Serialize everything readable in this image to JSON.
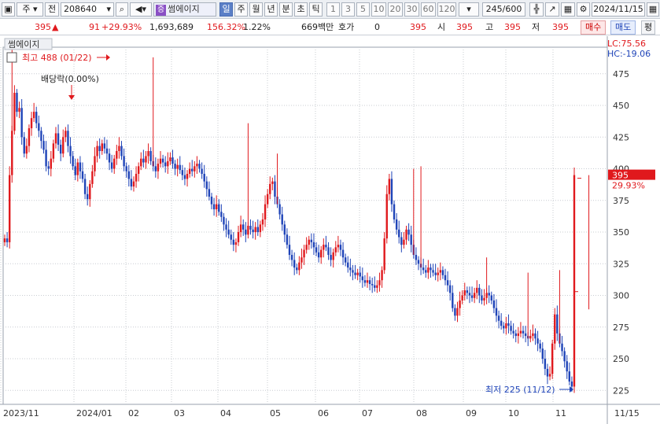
{
  "toolbar": {
    "market": "주",
    "prev_label": "전",
    "code": "208640",
    "name_tag": "증",
    "stock_name": "썸에이지",
    "periods": [
      "일",
      "주",
      "월",
      "년",
      "분",
      "초",
      "틱"
    ],
    "active_period": "일",
    "intervals": [
      "1",
      "3",
      "5",
      "10",
      "20",
      "30",
      "60",
      "120"
    ],
    "count": "245/600",
    "date": "2024/11/15"
  },
  "quote": {
    "price": "395",
    "change": "91",
    "change_pct": "+29.93%",
    "volume": "1,693,689",
    "volume_ratio": "156.32%",
    "turnover_pct": "1.22%",
    "amount": "669백만",
    "hoga_label": "호가",
    "hoga_value": "0",
    "hoga_price": "395",
    "open_label": "시",
    "open": "395",
    "high_label": "고",
    "high": "395",
    "low_label": "저",
    "low": "395",
    "buy_label": "매수",
    "sell_label": "매도",
    "avg_label": "평"
  },
  "chart_data": {
    "type": "candlestick",
    "title": "썸에이지",
    "y_ticks": [
      225,
      250,
      275,
      300,
      325,
      350,
      375,
      400,
      425,
      450,
      475
    ],
    "ylim": [
      214,
      496
    ],
    "x_labels": [
      "2023/11",
      "2024/01",
      "02",
      "03",
      "04",
      "05",
      "06",
      "07",
      "08",
      "09",
      "10",
      "11",
      "11/15"
    ],
    "current_price": "395",
    "current_change": "29.93%",
    "lc_label": "LC:75.56",
    "hc_label": "HC:-19.06",
    "high_annotation": "최고 488 (01/22)",
    "low_annotation": "최저 225 (11/12)",
    "dividend_annotation": "배당락(0.00%)",
    "colors": {
      "up": "#e0191d",
      "down": "#1f44b8",
      "grid": "#c8ccd2",
      "price_box": "#e0191d"
    },
    "close_series": [
      345,
      342,
      395,
      430,
      460,
      445,
      448,
      425,
      412,
      418,
      432,
      440,
      445,
      436,
      430,
      422,
      415,
      402,
      400,
      408,
      420,
      428,
      419,
      412,
      425,
      430,
      418,
      410,
      402,
      395,
      405,
      398,
      392,
      380,
      376,
      388,
      398,
      410,
      418,
      414,
      420,
      416,
      412,
      405,
      400,
      408,
      414,
      418,
      410,
      402,
      398,
      392,
      386,
      390,
      396,
      402,
      408,
      405,
      410,
      414,
      406,
      402,
      398,
      404,
      408,
      405,
      402,
      406,
      409,
      404,
      400,
      403,
      399,
      395,
      392,
      396,
      400,
      398,
      402,
      404,
      400,
      396,
      390,
      384,
      378,
      372,
      368,
      372,
      366,
      362,
      356,
      352,
      348,
      344,
      340,
      342,
      350,
      356,
      352,
      348,
      355,
      352,
      350,
      354,
      350,
      356,
      360,
      372,
      380,
      388,
      390,
      378,
      372,
      364,
      356,
      348,
      340,
      332,
      328,
      322,
      320,
      326,
      330,
      336,
      340,
      344,
      342,
      338,
      334,
      330,
      336,
      340,
      338,
      332,
      328,
      334,
      338,
      340,
      336,
      330,
      326,
      322,
      320,
      318,
      316,
      318,
      315,
      312,
      310,
      312,
      309,
      308,
      306,
      308,
      312,
      320,
      345,
      380,
      392,
      372,
      360,
      352,
      346,
      340,
      344,
      352,
      348,
      340,
      332,
      328,
      325,
      322,
      320,
      318,
      322,
      320,
      318,
      316,
      318,
      320,
      316,
      312,
      308,
      302,
      290,
      284,
      290,
      296,
      300,
      304,
      302,
      300,
      298,
      302,
      306,
      300,
      296,
      298,
      302,
      300,
      296,
      290,
      284,
      280,
      276,
      274,
      278,
      276,
      272,
      270,
      268,
      270,
      272,
      270,
      268,
      266,
      268,
      270,
      266,
      262,
      258,
      250,
      242,
      236,
      238,
      262,
      285,
      270,
      262,
      256,
      248,
      240,
      232,
      228,
      395
    ]
  }
}
